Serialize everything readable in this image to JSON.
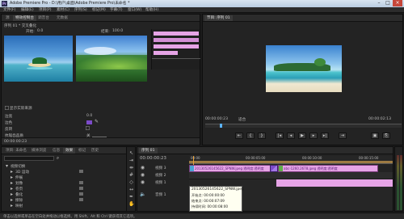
{
  "titlebar": {
    "title": "Adobe Premiere Pro - D:\\用户\\桌面\\Adobe Premiere Pro\\未命名 *",
    "window_controls": [
      "–",
      "□",
      "×"
    ]
  },
  "menubar": {
    "items": [
      "文件(F)",
      "编辑(E)",
      "项目(P)",
      "素材(C)",
      "序列(S)",
      "标记(M)",
      "字幕(T)",
      "窗口(W)",
      "帮助(H)"
    ]
  },
  "source_panel": {
    "tabs": [
      "源",
      "特效控制台",
      "调音台",
      "元数据"
    ],
    "sub_header": "序列 01 * 交叉叠化",
    "start_label": "开始:",
    "start_value": "0.0",
    "end_label": "结束:",
    "end_value": "100.0",
    "checkbox_label": "显示实际来源",
    "props": [
      {
        "label": "边宽",
        "value": "0.0"
      },
      {
        "label": "边色",
        "value": ""
      },
      {
        "label": "反转",
        "value": ""
      },
      {
        "label": "抗锯齿品质",
        "value": "关"
      }
    ],
    "timecode": "00:00:00:23"
  },
  "program_panel": {
    "tabs": [
      "节目: 序列 01"
    ],
    "timecode_left": "00:00:00:23",
    "fit_label": "适合",
    "timecode_right": "00:00:02:13",
    "transport_icons": [
      "⇤",
      "{",
      "}",
      "|◂",
      "◂",
      "▶",
      "▸",
      "▸|",
      "⇥",
      "▣",
      "⎘"
    ]
  },
  "project_panel": {
    "tabs": [
      "项目: 未命名",
      "媒体浏览",
      "信息",
      "效果",
      "标记",
      "历史"
    ],
    "tree_root": "视频切换",
    "tree_items": [
      "3D 运动",
      "伸展",
      "划像",
      "卷页",
      "叠化",
      "擦除",
      "映射"
    ]
  },
  "timeline_panel": {
    "tabs": [
      "序列 01"
    ],
    "timecode": "00:00:00:23",
    "ruler_labels": [
      "00:00",
      "00:00:05:00",
      "00:00:10:00",
      "00:00:15:00"
    ],
    "tracks": [
      {
        "name": "视频 3"
      },
      {
        "name": "视频 2"
      },
      {
        "name": "视频 1"
      },
      {
        "name": "音频 1"
      }
    ],
    "clips": [
      {
        "label": "20130526145622_SPNW.jpeg 透明度:透明度"
      },
      {
        "label": "abc-1260.2678.jpeg 透明度:透明度"
      }
    ],
    "tooltip": {
      "title": "20130526145622_SPNW.jpeg",
      "lines": [
        "开始点: 00:00:00:00",
        "结束点: 00:00:07:09",
        "持续时间: 00:00:08:00"
      ]
    }
  },
  "statusbar": {
    "text": "单击以选择或单击在空白处并拖动以框选择。用 Shift、Alt 和 Ctrl 键获得其它选项。"
  },
  "colors": {
    "accent": "#e8a23a",
    "clip_pink": "#e6a4e6",
    "clip_purple": "#7c4bc9",
    "purple_text": "#c069e8"
  }
}
